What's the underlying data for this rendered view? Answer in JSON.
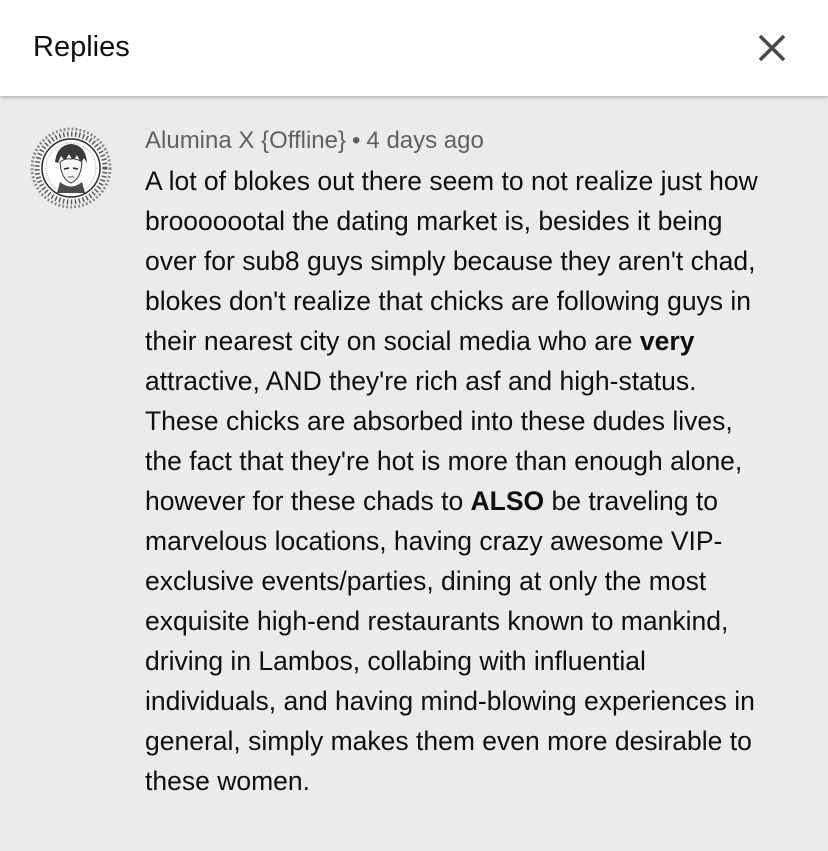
{
  "header": {
    "title": "Replies",
    "close_icon": "close-icon"
  },
  "comment": {
    "author": "Alumina X {Offline}",
    "separator": "•",
    "time": "4 days ago",
    "avatar_icon": "anime-portrait-avatar",
    "body_lines": [
      "A lot of blokes out there seem to not realize just how",
      "brooooootal the dating market is, besides it being",
      "over for sub8 guys simply because they aren't chad,",
      "blokes don't realize that chicks are following guys in",
      "their nearest city on social media who are ",
      "very",
      "attractive, AND they're rich asf and high-status.",
      "These chicks are absorbed into these dudes lives,",
      "the fact that they're hot is more than enough alone,",
      "however for these chads to ",
      "ALSO",
      " be traveling to",
      "marvelous locations, having crazy awesome VIP-",
      "exclusive events/parties, dining at only the most",
      "exquisite high-end restaurants known to mankind,",
      "driving in Lambos, collabing with influential",
      "individuals, and having mind-blowing experiences in",
      "general, simply makes them even more desirable to",
      "these women."
    ]
  },
  "colors": {
    "background": "#ebebeb",
    "header_bg": "#ffffff",
    "meta_text": "#606060",
    "body_text": "#0f0f0f"
  }
}
